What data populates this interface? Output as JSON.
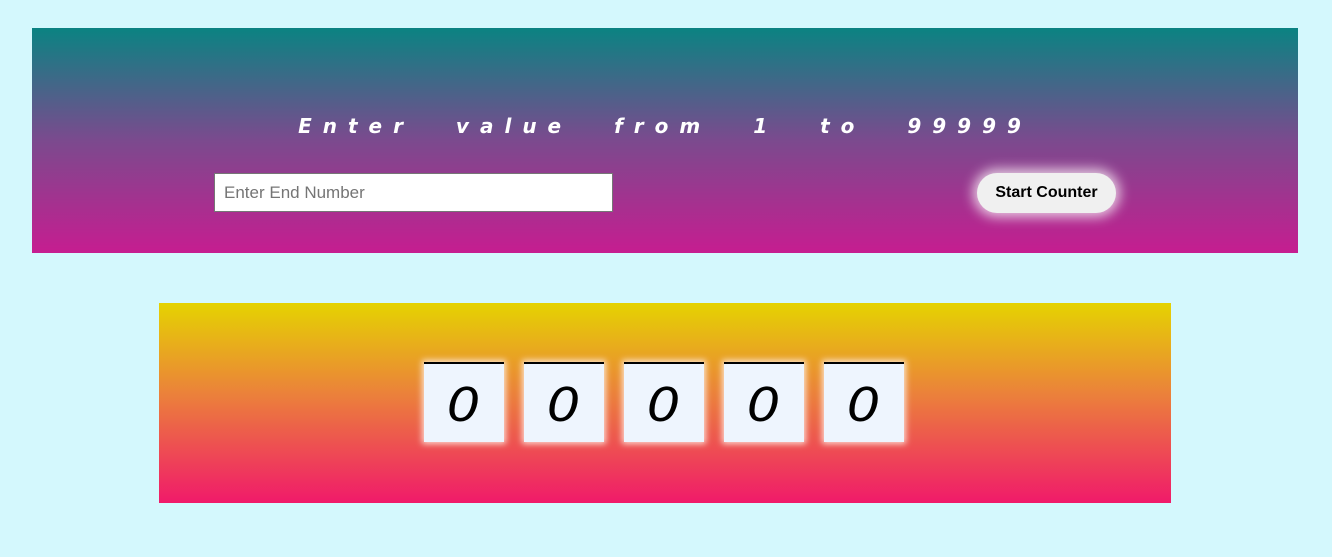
{
  "header": {
    "instruction": "Enter value from 1 to 99999",
    "input": {
      "placeholder": "Enter End Number",
      "value": ""
    },
    "start_button_label": "Start Counter"
  },
  "counter": {
    "digits": [
      "0",
      "0",
      "0",
      "0",
      "0"
    ]
  },
  "colors": {
    "page_background": "#d4f8fd",
    "header_gradient": [
      "#0a8382",
      "#7b4a8e",
      "#c61d90"
    ],
    "counter_gradient": [
      "#e5d301",
      "#eb823a",
      "#f01a6a"
    ],
    "digit_box_background": "#eef5fe"
  }
}
